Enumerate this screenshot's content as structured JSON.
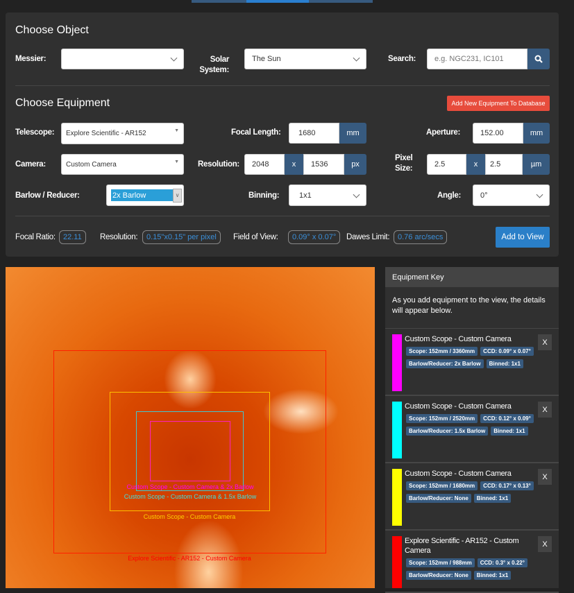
{
  "choose_object": {
    "title": "Choose Object",
    "messier_label": "Messier:",
    "messier_value": "",
    "solar_label_1": "Solar",
    "solar_label_2": "System:",
    "solar_value": "The Sun",
    "search_label": "Search:",
    "search_placeholder": "e.g. NGC231, IC101",
    "search_icon": "search-icon"
  },
  "choose_equipment": {
    "title": "Choose Equipment",
    "add_new_label": "Add New Equipment To Database",
    "telescope_label": "Telescope:",
    "telescope_value": "Explore Scientific - AR152",
    "focal_length_label": "Focal Length:",
    "focal_length_value": "1680",
    "mm": "mm",
    "aperture_label": "Aperture:",
    "aperture_value": "152.00",
    "camera_label": "Camera:",
    "camera_value": "Custom Camera",
    "resolution_label": "Resolution:",
    "res_x": "2048",
    "x": "x",
    "res_y": "1536",
    "px": "px",
    "pixel_label_1": "Pixel",
    "pixel_label_2": "Size:",
    "pix_x": "2.5",
    "pix_y": "2.5",
    "um": "µm",
    "barlow_label": "Barlow / Reducer:",
    "barlow_value": "2x Barlow",
    "binning_label": "Binning:",
    "binning_value": "1x1",
    "angle_label": "Angle:",
    "angle_value": "0°"
  },
  "stats": {
    "focal_ratio_label": "Focal Ratio:",
    "focal_ratio": "22.11",
    "resolution_label": "Resolution:",
    "resolution": "0.15\"x0.15\" per pixel",
    "fov_label": "Field of View:",
    "fov": "0.09° x 0.07°",
    "dawes_label": "Dawes Limit:",
    "dawes": "0.76 arc/secs",
    "add_to_view": "Add to View"
  },
  "overlays": [
    {
      "label": "Custom Scope - Custom Camera  & 2x Barlow",
      "color": "#ff00ff"
    },
    {
      "label": "Custom Scope - Custom Camera  & 1.5x Barlow",
      "color": "#00ffff"
    },
    {
      "label": "Custom Scope - Custom Camera",
      "color": "#ffff00"
    },
    {
      "label": "Explore Scientific - AR152 - Custom Camera",
      "color": "#ff0000"
    }
  ],
  "key": {
    "title": "Equipment Key",
    "intro": "As you add equipment to the view, the details will appear below.",
    "remove": "X",
    "items": [
      {
        "color": "#ff00ff",
        "title": "Custom Scope - Custom Camera",
        "scope": "Scope: 152mm / 3360mm",
        "ccd": "CCD: 0.09° x 0.07°",
        "barlow": "Barlow/Reducer: 2x Barlow",
        "binned": "Binned: 1x1"
      },
      {
        "color": "#00ffff",
        "title": "Custom Scope - Custom Camera",
        "scope": "Scope: 152mm / 2520mm",
        "ccd": "CCD: 0.12° x 0.09°",
        "barlow": "Barlow/Reducer: 1.5x Barlow",
        "binned": "Binned: 1x1"
      },
      {
        "color": "#ffff00",
        "title": "Custom Scope - Custom Camera",
        "scope": "Scope: 152mm / 1680mm",
        "ccd": "CCD: 0.17° x 0.13°",
        "barlow": "Barlow/Reducer: None",
        "binned": "Binned: 1x1"
      },
      {
        "color": "#ff0000",
        "title": "Explore Scientific - AR152 - Custom Camera",
        "scope": "Scope: 152mm / 988mm",
        "ccd": "CCD: 0.3° x 0.22°",
        "barlow": "Barlow/Reducer: None",
        "binned": "Binned: 1x1"
      }
    ]
  }
}
